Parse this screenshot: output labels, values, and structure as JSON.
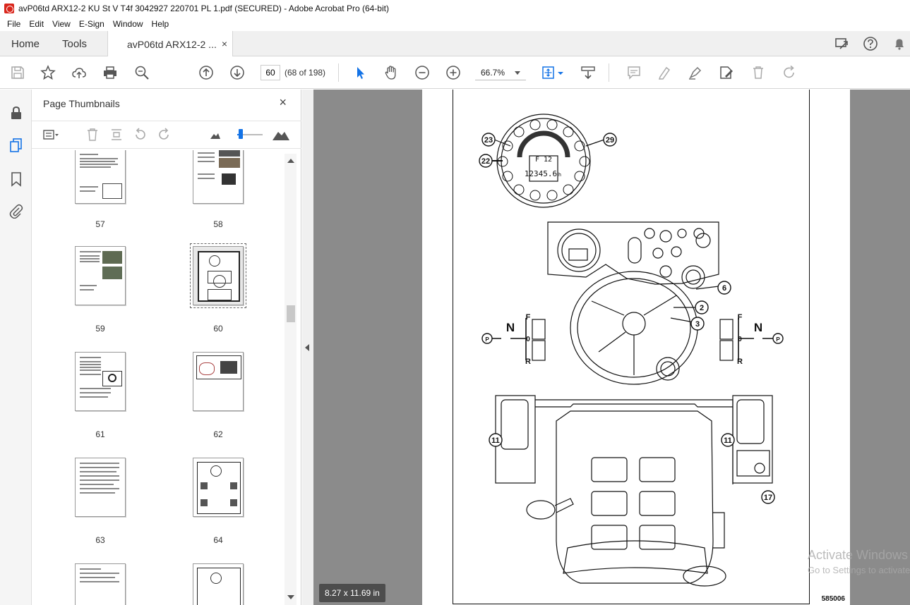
{
  "window": {
    "title": "avP06td ARX12-2 KU St V T4f 3042927 220701 PL 1.pdf (SECURED) - Adobe Acrobat Pro (64-bit)"
  },
  "menu": [
    "File",
    "Edit",
    "View",
    "E-Sign",
    "Window",
    "Help"
  ],
  "tabs": {
    "home": "Home",
    "tools": "Tools",
    "doc": "avP06td ARX12-2 ...",
    "close": "×"
  },
  "toolbar": {
    "page_value": "60",
    "page_count": "(68 of 198)",
    "zoom": "66.7%"
  },
  "panel": {
    "title": "Page Thumbnails",
    "close": "×",
    "thumbs": [
      {
        "label": "57"
      },
      {
        "label": "58"
      },
      {
        "label": "59"
      },
      {
        "label": "60"
      },
      {
        "label": "61"
      },
      {
        "label": "62"
      },
      {
        "label": "63"
      },
      {
        "label": "64"
      }
    ]
  },
  "document": {
    "figure_id": "585006",
    "page_size": "8.27 x 11.69 in",
    "callouts": [
      "23",
      "29",
      "22",
      "6",
      "2",
      "3",
      "11",
      "11",
      "17"
    ],
    "shift_labels": {
      "f": "F",
      "n": "N",
      "zero": "0",
      "r": "R",
      "p": "P"
    },
    "display": {
      "gear": "F 12",
      "hours": "12345.6",
      "unit": "h"
    }
  },
  "watermark": {
    "line1": "Activate Windows",
    "line2": "Go to Settings to activate Windows."
  },
  "colors": {
    "accent": "#1473e6",
    "doc_bg": "#8b8b8b",
    "brand_red": "#d9261c"
  }
}
